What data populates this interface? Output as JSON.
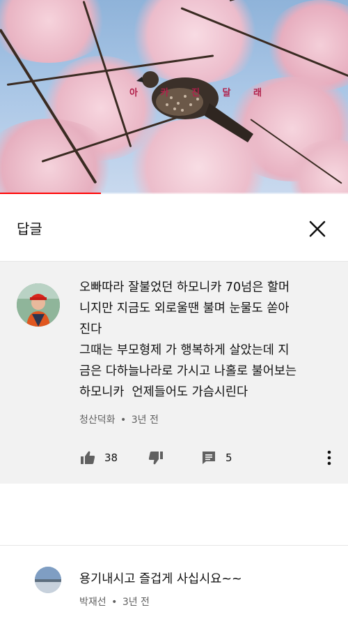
{
  "video": {
    "overlay_caption": "아 카 진 달 래",
    "progress_fraction": 0.29
  },
  "panel": {
    "title": "답글",
    "close_icon": "close-icon"
  },
  "comment": {
    "text": "오빠따라 잘불었던 하모니카 70넘은 할머\n니지만 지금도 외로울땐 불며 눈물도 쏟아\n진다\n그때는 부모형제 가 행복하게 살았는데 지\n금은 다하늘나라로 가시고 나홀로 불어보는\n하모니카  언제들어도 가슴시린다",
    "author": "청산덕화",
    "separator": "•",
    "time": "3년 전",
    "likes": "38",
    "replies": "5",
    "icons": [
      "thumbs-up-icon",
      "thumbs-down-icon",
      "reply-icon",
      "more-vert-icon"
    ]
  },
  "reply": {
    "text": "용기내시고 즐겁게 사십시요~~",
    "author": "박재선",
    "separator": "•",
    "time": "3년 전"
  },
  "colors": {
    "progress": "#ff0000",
    "comment_bg": "#f2f2f2",
    "meta_text": "#606060"
  }
}
